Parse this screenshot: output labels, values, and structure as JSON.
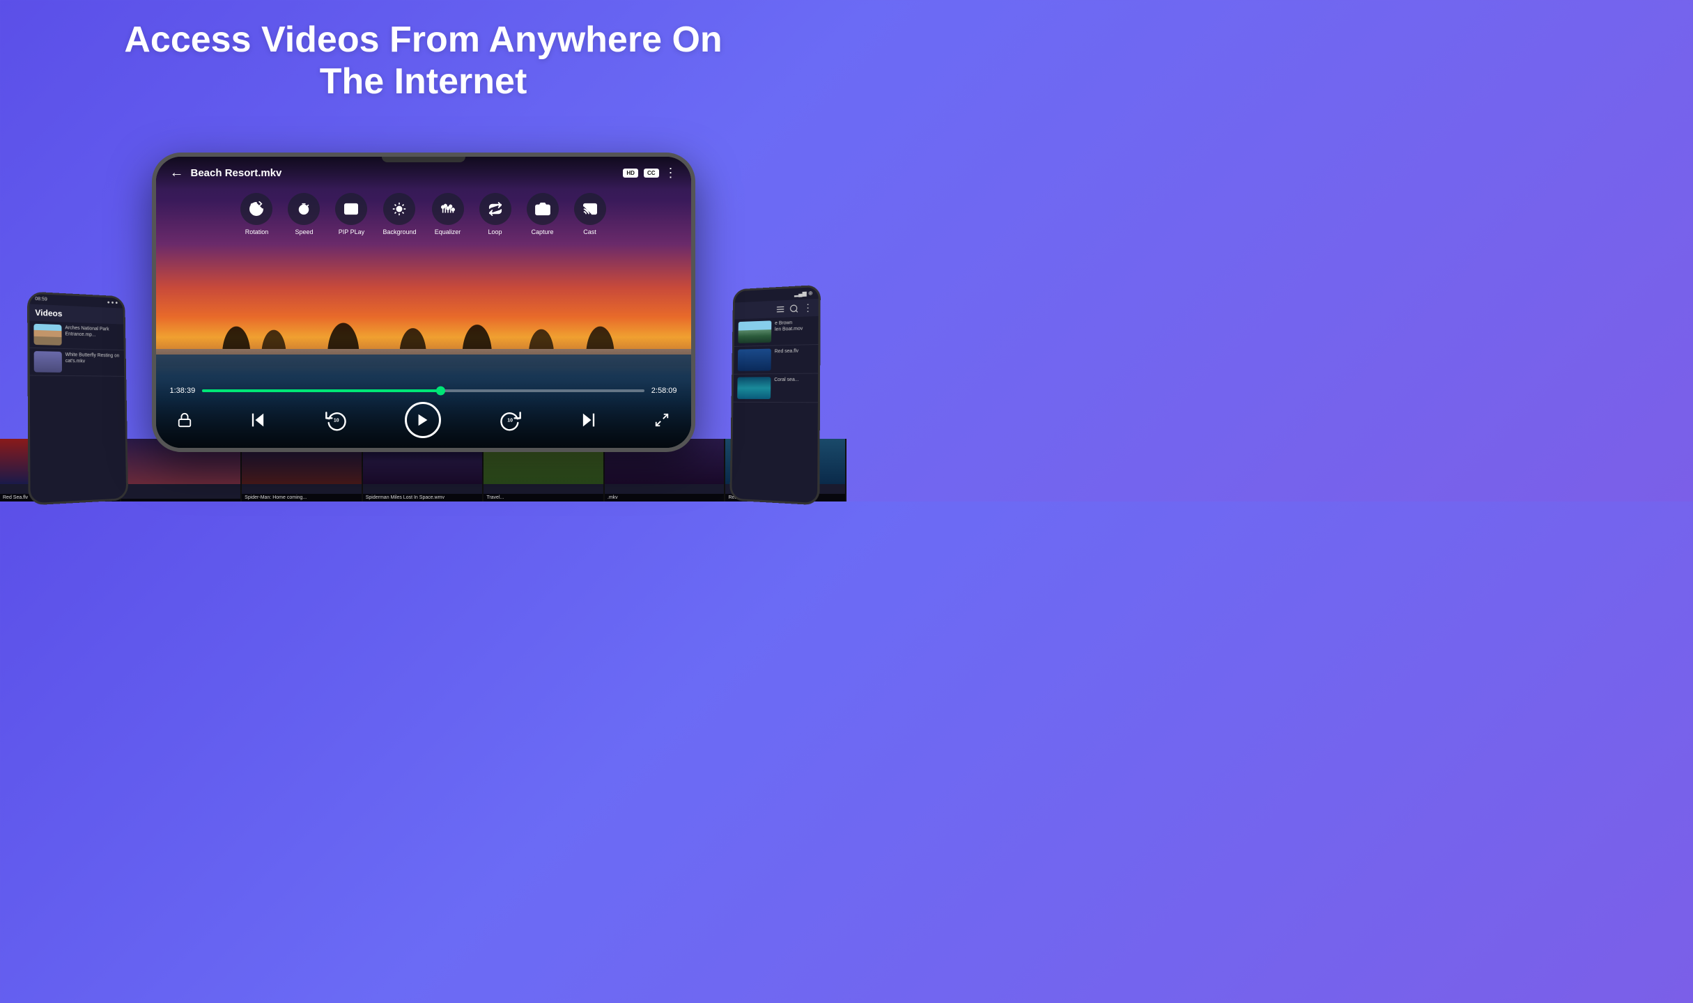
{
  "headline": {
    "line1": "Access Videos From Anywhere On",
    "line2": "The Internet"
  },
  "player": {
    "title": "Beach Resort.mkv",
    "time_current": "1:38:39",
    "time_total": "2:58:09",
    "badges": [
      "HD",
      "CC"
    ],
    "controls": [
      {
        "id": "rotation",
        "label": "Rotation",
        "icon": "rotation"
      },
      {
        "id": "speed",
        "label": "Speed",
        "icon": "speed"
      },
      {
        "id": "pip-play",
        "label": "PIP PLay",
        "icon": "pip"
      },
      {
        "id": "background",
        "label": "Background",
        "icon": "background"
      },
      {
        "id": "equalizer",
        "label": "Equalizer",
        "icon": "equalizer"
      },
      {
        "id": "loop",
        "label": "Loop",
        "icon": "loop"
      },
      {
        "id": "capture",
        "label": "Capture",
        "icon": "capture"
      },
      {
        "id": "cast",
        "label": "Cast",
        "icon": "cast"
      }
    ]
  },
  "left_phone": {
    "time": "08:59",
    "title": "Videos",
    "items": [
      {
        "title": "Arches National Park Entrance.mp..."
      },
      {
        "title": "White Butterfly Resting on cat's.mkv"
      }
    ]
  },
  "right_phone": {
    "items": [
      {
        "title": "e Brown\nlen Boat.mov"
      },
      {
        "title": "Red sea.flv"
      }
    ]
  },
  "filmstrip": [
    {
      "label": "Red Sea.flv",
      "color": "red"
    },
    {
      "label": "",
      "color": "spider"
    },
    {
      "label": "Spider-Man: Home coming...",
      "color": "spider"
    },
    {
      "label": "Spiderman Miles Lost In Space.wmv",
      "color": "space"
    },
    {
      "label": "Travel...",
      "color": "travel"
    },
    {
      "label": ".mkv",
      "color": "mkv"
    },
    {
      "label": "Red sea.flv",
      "color": "sea"
    }
  ]
}
